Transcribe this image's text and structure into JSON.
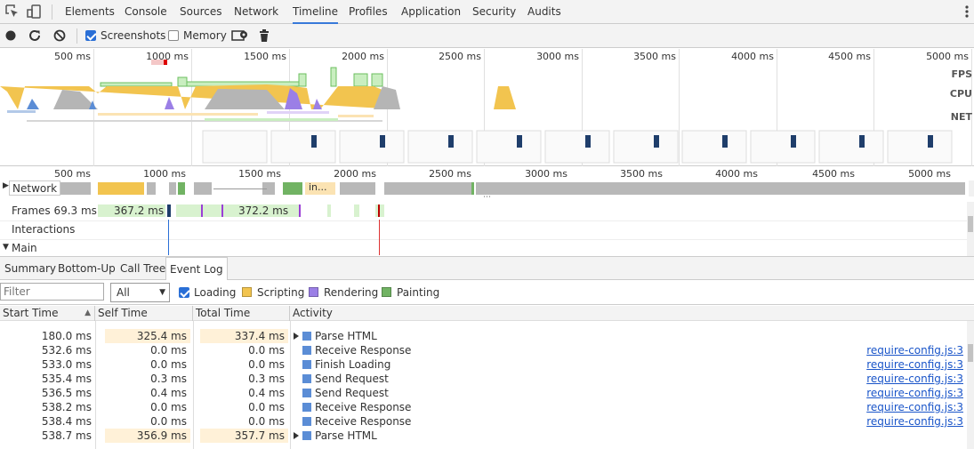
{
  "tabs": [
    "Elements",
    "Console",
    "Sources",
    "Network",
    "Timeline",
    "Profiles",
    "Application",
    "Security",
    "Audits"
  ],
  "active_tab": "Timeline",
  "toolbar": {
    "screenshots_label": "Screenshots",
    "screenshots_checked": true,
    "memory_label": "Memory",
    "memory_checked": false
  },
  "overview": {
    "ticks": [
      "500 ms",
      "1000 ms",
      "1500 ms",
      "2000 ms",
      "2500 ms",
      "3000 ms",
      "3500 ms",
      "4000 ms",
      "4500 ms",
      "5000 ms"
    ],
    "tracks": [
      "FPS",
      "CPU",
      "NET"
    ]
  },
  "detail": {
    "ticks": [
      "500 ms",
      "1000 ms",
      "1500 ms",
      "2000 ms",
      "2500 ms",
      "3000 ms",
      "3500 ms",
      "4000 ms",
      "4500 ms",
      "5000 ms"
    ],
    "network_label": "Network",
    "network_chip": "in...",
    "frames_label": "Frames 69.3 ms",
    "frame_1": "367.2 ms",
    "frame_2": "372.2 ms",
    "interactions_label": "Interactions",
    "main_label": "Main"
  },
  "subtabs": [
    "Summary",
    "Bottom-Up",
    "Call Tree",
    "Event Log"
  ],
  "active_subtab": "Event Log",
  "filter": {
    "placeholder": "Filter",
    "select_value": "All",
    "legend": [
      {
        "label": "Loading",
        "color": "#2a6fd6",
        "checkbox": true
      },
      {
        "label": "Scripting",
        "color": "#f2c44f"
      },
      {
        "label": "Rendering",
        "color": "#9b7fe6"
      },
      {
        "label": "Painting",
        "color": "#71b363"
      }
    ]
  },
  "table": {
    "headers": [
      "Start Time",
      "Self Time",
      "Total Time",
      "Activity"
    ],
    "rows": [
      {
        "start": "180.0 ms",
        "self": "325.4 ms",
        "total": "337.4 ms",
        "activity": "Parse HTML",
        "expandable": true,
        "link": "",
        "hl": true
      },
      {
        "start": "532.6 ms",
        "self": "0.0 ms",
        "total": "0.0 ms",
        "activity": "Receive Response",
        "expandable": false,
        "link": "require-config.js:3",
        "hl": false
      },
      {
        "start": "533.0 ms",
        "self": "0.0 ms",
        "total": "0.0 ms",
        "activity": "Finish Loading",
        "expandable": false,
        "link": "require-config.js:3",
        "hl": false
      },
      {
        "start": "535.4 ms",
        "self": "0.3 ms",
        "total": "0.3 ms",
        "activity": "Send Request",
        "expandable": false,
        "link": "require-config.js:3",
        "hl": false
      },
      {
        "start": "536.5 ms",
        "self": "0.4 ms",
        "total": "0.4 ms",
        "activity": "Send Request",
        "expandable": false,
        "link": "require-config.js:3",
        "hl": false
      },
      {
        "start": "538.2 ms",
        "self": "0.0 ms",
        "total": "0.0 ms",
        "activity": "Receive Response",
        "expandable": false,
        "link": "require-config.js:3",
        "hl": false
      },
      {
        "start": "538.4 ms",
        "self": "0.0 ms",
        "total": "0.0 ms",
        "activity": "Receive Response",
        "expandable": false,
        "link": "require-config.js:3",
        "hl": false
      },
      {
        "start": "538.7 ms",
        "self": "356.9 ms",
        "total": "357.7 ms",
        "activity": "Parse HTML",
        "expandable": true,
        "link": "",
        "hl": true
      }
    ]
  }
}
